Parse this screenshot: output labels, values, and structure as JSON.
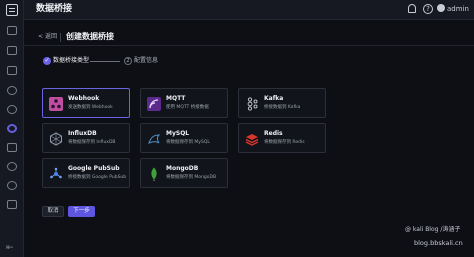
{
  "app": {
    "title": "数据桥接",
    "user": "admin"
  },
  "header": {
    "back_label": "返回",
    "page_title": "创建数据桥接"
  },
  "steps": [
    {
      "number": "1",
      "label": "数据桥接类型",
      "state": "done"
    },
    {
      "number": "2",
      "label": "配置信息",
      "state": "pending"
    }
  ],
  "bridges": [
    {
      "name": "Webhook",
      "desc": "发送数据到 Webhook",
      "icon": "webhook-icon",
      "selected": true
    },
    {
      "name": "MQTT",
      "desc": "使用 MQTT 桥接数据",
      "icon": "mqtt-icon",
      "selected": false
    },
    {
      "name": "Kafka",
      "desc": "桥接数据到 Kafka",
      "icon": "kafka-icon",
      "selected": false
    },
    {
      "name": "InfluxDB",
      "desc": "将数据保存到 InfluxDB",
      "icon": "influxdb-icon",
      "selected": false
    },
    {
      "name": "MySQL",
      "desc": "将数据保存到 MySQL",
      "icon": "mysql-icon",
      "selected": false
    },
    {
      "name": "Redis",
      "desc": "将数据保存到 Redis",
      "icon": "redis-icon",
      "selected": false
    },
    {
      "name": "Google PubSub",
      "desc": "桥接数据到 Google PubSub",
      "icon": "google-pubsub-icon",
      "selected": false
    },
    {
      "name": "MongoDB",
      "desc": "将数据保存到 MongoDB",
      "icon": "mongodb-icon",
      "selected": false
    }
  ],
  "actions": {
    "cancel_label": "取消",
    "next_label": "下一步"
  },
  "watermark": {
    "line1": "@ kali Blog /涛涵子",
    "line2": "blog.bbskali.cn"
  },
  "colors": {
    "accent": "#6b63e6",
    "background": "#0d0f14",
    "card": "#11141b"
  }
}
